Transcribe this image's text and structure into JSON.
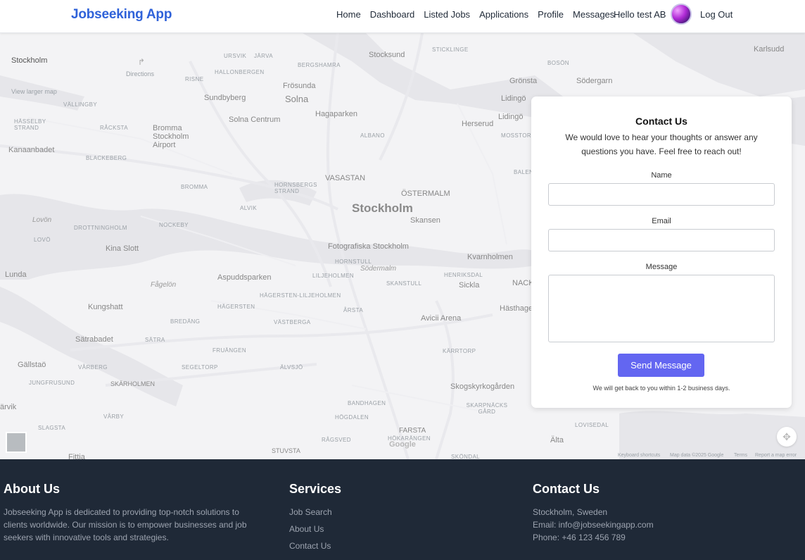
{
  "header": {
    "brand": "Jobseeking App",
    "nav": [
      "Home",
      "Dashboard",
      "Listed Jobs",
      "Applications",
      "Profile",
      "Messages"
    ],
    "greeting": "Hello test AB",
    "logout": "Log Out"
  },
  "map": {
    "place_title": "Stockholm",
    "directions": "Directions",
    "view_larger": "View larger map",
    "center_label": "Stockholm",
    "labels": {
      "ursvik": "URSVIK",
      "jarva": "JÄRVA",
      "bergshamra": "BERGSHAMRA",
      "stocksund": "Stocksund",
      "stickinge": "STICKLINGE",
      "karlsudd": "Karlsudd",
      "hallonbergen": "HALLONBERGEN",
      "risne": "RISNE",
      "frosunda": "Frösunda",
      "boson": "BOSÖN",
      "gronsta": "Grönsta",
      "sodergarn": "Södergarn",
      "sundbyberg": "Sundbyberg",
      "solna": "Solna",
      "vallingby": "VÄLLINGBY",
      "lidingo": "Lidingö",
      "solna_centrum": "Solna Centrum",
      "hagaparken": "Hagaparken",
      "herserud": "Herserud",
      "hasselby": "HÄSSELBY STRAND",
      "racksta": "RÅCKSTA",
      "bromma": "Bromma Stockholm Airport",
      "albano": "ALBANO",
      "mosstorp": "MOSSTORP",
      "kanaanbadet": "Kanaanbadet",
      "blackeberg": "BLACKEBERG",
      "vasastan": "VASASTAN",
      "balen": "BALEN",
      "hornsberg": "HORNSBERGS STRAND",
      "bromma2": "BROMMA",
      "ostermalm": "ÖSTERMALM",
      "alvik": "ALVIK",
      "lovon": "Lovön",
      "nockeby": "NOCKEBY",
      "skansen": "Skansen",
      "drottningholm": "DROTTNINGHOLM",
      "lovo": "LOVÖ",
      "kina": "Kina Slott",
      "fotografiska": "Fotografiska Stockholm",
      "kvarnholmen": "Kvarnholmen",
      "hornstull": "HORNSTULL",
      "sodermalm": "Södermalm",
      "lunda": "Lunda",
      "aspudden": "Aspuddsparken",
      "liljeholmen": "LILJEHOLMEN",
      "henriksdal": "HENRIKSDAL",
      "sickla": "Sickla",
      "nacka": "NACK",
      "fagelon": "Fågelön",
      "hagersten_lil": "HÄGERSTEN-LILJEHOLMEN",
      "skanstull": "SKANSTULL",
      "kungshatt": "Kungshatt",
      "hagersten": "HÄGERSTEN",
      "arsta": "ÅRSTA",
      "hasthagen": "Hästhage",
      "bredang": "BREDÄNG",
      "vastberga": "VÄSTBERGA",
      "avicii": "Avicii Arena",
      "satrabadet": "Sätrabadet",
      "satra": "SÄTRA",
      "karrtorp": "KÄRRTORP",
      "fruangen": "FRUÄNGEN",
      "gallstao": "Gällstaö",
      "segeltorp": "SEGELTORP",
      "alvsjo": "ÄLVSJÖ",
      "varberg": "VÅRBERG",
      "jungfrusund": "JUNGFRUSUND",
      "skarholmen": "SKÄRHOLMEN",
      "skogskyrkogarden": "Skogskyrkogården",
      "varvik": "ärvik",
      "bandhagen": "BANDHAGEN",
      "skarpnack": "SKARPNÄCKS GÅRD",
      "varby": "VÅRBY",
      "hogdalen": "HÖGDALEN",
      "lovisedal": "LOVISEDAL",
      "slagsta": "SLAGSTA",
      "farsta": "FARSTA",
      "alta": "Älta",
      "ragsved": "RÅGSVED",
      "hokarangen": "HÖKARÄNGEN",
      "stuvsta": "STUVSTA",
      "fittja": "Fittja",
      "skondal": "SKÖNDAL"
    },
    "footer": {
      "keyboard": "Keyboard shortcuts",
      "mapdata": "Map data ©2025 Google",
      "terms": "Terms",
      "report": "Report a map error",
      "google": "Google"
    }
  },
  "contact_card": {
    "title": "Contact Us",
    "intro": "We would love to hear your thoughts or answer any questions you have. Feel free to reach out!",
    "name_label": "Name",
    "name_value": "",
    "email_label": "Email",
    "email_value": "",
    "message_label": "Message",
    "message_value": "",
    "send_label": "Send Message",
    "note": "We will get back to you within 1-2 business days.",
    "button_color": "#6366f1"
  },
  "footer": {
    "about": {
      "title": "About Us",
      "text": "Jobseeking App is dedicated to providing top-notch solutions to clients worldwide. Our mission is to empower businesses and job seekers with innovative tools and strategies."
    },
    "services": {
      "title": "Services",
      "links": [
        "Job Search",
        "About Us",
        "Contact Us"
      ]
    },
    "contact": {
      "title": "Contact Us",
      "location": "Stockholm, Sweden",
      "email": "Email: info@jobseekingapp.com",
      "phone": "Phone: +46 123 456 789"
    },
    "bg_color": "#1f2937"
  }
}
